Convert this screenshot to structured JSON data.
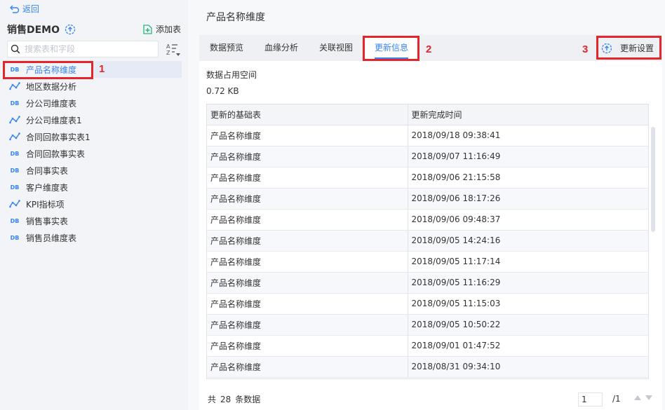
{
  "sidebar": {
    "back_label": "返回",
    "package_name": "销售DEMO",
    "add_table_label": "添加表",
    "search_placeholder": "搜索表和字段",
    "items": [
      {
        "label": "产品名称维度",
        "icon": "db-icon",
        "active": true
      },
      {
        "label": "地区数据分析",
        "icon": "etl-icon"
      },
      {
        "label": "分公司维度表",
        "icon": "db-icon"
      },
      {
        "label": "分公司维度表1",
        "icon": "etl-icon"
      },
      {
        "label": "合同回款事实表1",
        "icon": "etl-icon"
      },
      {
        "label": "合同回款事实表",
        "icon": "db-icon"
      },
      {
        "label": "合同事实表",
        "icon": "db-icon"
      },
      {
        "label": "客户维度表",
        "icon": "db-icon"
      },
      {
        "label": "KPI指标项",
        "icon": "etl-icon"
      },
      {
        "label": "销售事实表",
        "icon": "db-icon"
      },
      {
        "label": "销售员维度表",
        "icon": "db-icon"
      }
    ],
    "db_badge": "DB"
  },
  "main": {
    "title": "产品名称维度",
    "tabs": [
      {
        "label": "数据预览"
      },
      {
        "label": "血缘分析"
      },
      {
        "label": "关联视图"
      },
      {
        "label": "更新信息",
        "active": true
      }
    ],
    "settings_label": "更新设置",
    "usage_label": "数据占用空间",
    "usage_value": "0.72 KB",
    "table": {
      "columns": [
        "更新的基础表",
        "更新完成时间"
      ],
      "rows": [
        [
          "产品名称维度",
          "2018/09/18 09:38:41"
        ],
        [
          "产品名称维度",
          "2018/09/07 11:16:49"
        ],
        [
          "产品名称维度",
          "2018/09/06 21:15:58"
        ],
        [
          "产品名称维度",
          "2018/09/06 18:17:26"
        ],
        [
          "产品名称维度",
          "2018/09/06 09:48:37"
        ],
        [
          "产品名称维度",
          "2018/09/05 14:24:16"
        ],
        [
          "产品名称维度",
          "2018/09/05 11:17:14"
        ],
        [
          "产品名称维度",
          "2018/09/05 11:16:29"
        ],
        [
          "产品名称维度",
          "2018/09/05 11:15:03"
        ],
        [
          "产品名称维度",
          "2018/09/05 10:50:22"
        ],
        [
          "产品名称维度",
          "2018/09/01 01:47:52"
        ],
        [
          "产品名称维度",
          "2018/08/31 09:34:10"
        ]
      ]
    },
    "footer": {
      "total_prefix": "共",
      "total_count": "28",
      "total_suffix": "条数据",
      "page_value": "1",
      "page_total": "/1"
    }
  },
  "annotations": {
    "marker_1": "1",
    "marker_2": "2",
    "marker_3": "3",
    "color": "#e4252b"
  },
  "colors": {
    "accent": "#3685f2",
    "add_icon": "#2bb37a"
  }
}
